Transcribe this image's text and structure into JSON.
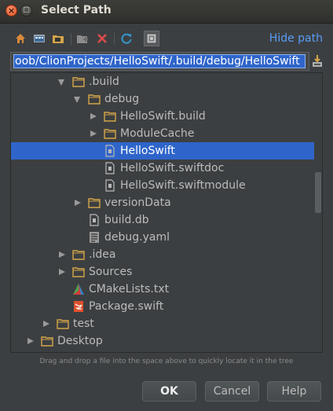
{
  "window": {
    "title": "Select Path"
  },
  "toolbar": {
    "icons": [
      "home-icon",
      "desktop-icon",
      "project-icon",
      "new-folder-icon",
      "delete-icon",
      "refresh-icon",
      "show-hidden-icon"
    ],
    "hide_path_label": "Hide path"
  },
  "path": {
    "value": "oob/ClionProjects/HelloSwift/.build/debug/HelloSwift"
  },
  "tree": {
    "items": [
      {
        "label": ".build",
        "type": "folder",
        "expanded": true
      },
      {
        "label": "debug",
        "type": "folder",
        "expanded": true
      },
      {
        "label": "HelloSwift.build",
        "type": "folder",
        "expanded": false
      },
      {
        "label": "ModuleCache",
        "type": "folder",
        "expanded": false
      },
      {
        "label": "HelloSwift",
        "type": "file",
        "selected": true
      },
      {
        "label": "HelloSwift.swiftdoc",
        "type": "file"
      },
      {
        "label": "HelloSwift.swiftmodule",
        "type": "file"
      },
      {
        "label": "versionData",
        "type": "folder",
        "expanded": false
      },
      {
        "label": "build.db",
        "type": "file"
      },
      {
        "label": "debug.yaml",
        "type": "yaml"
      },
      {
        "label": ".idea",
        "type": "folder",
        "expanded": false
      },
      {
        "label": "Sources",
        "type": "folder",
        "expanded": false
      },
      {
        "label": "CMakeLists.txt",
        "type": "cmake"
      },
      {
        "label": "Package.swift",
        "type": "swift"
      },
      {
        "label": "test",
        "type": "folder",
        "expanded": false
      },
      {
        "label": "Desktop",
        "type": "folder",
        "expanded": false
      }
    ]
  },
  "hint": "Drag and drop a file into the space above to quickly locate it in the tree",
  "buttons": {
    "ok": "OK",
    "cancel": "Cancel",
    "help": "Help"
  },
  "colors": {
    "selection": "#2f65ca",
    "link": "#589df6",
    "background": "#3c3f41"
  }
}
